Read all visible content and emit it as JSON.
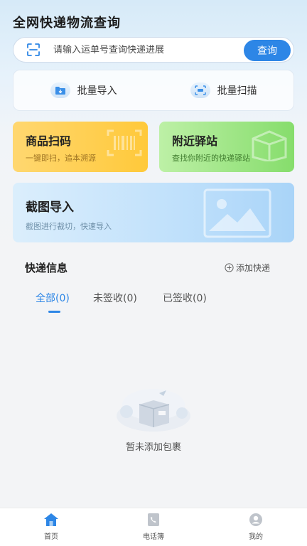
{
  "app": {
    "title": "全网快递物流查询"
  },
  "search": {
    "placeholder": "请输入运单号查询快递进展",
    "button_label": "查询"
  },
  "batch_actions": [
    {
      "label": "批量导入",
      "icon": "import-icon"
    },
    {
      "label": "批量扫描",
      "icon": "scan-icon"
    }
  ],
  "feature_cards": {
    "product_scan": {
      "title": "商品扫码",
      "subtitle": "一键即扫，追本溯源",
      "icon": "barcode-icon"
    },
    "nearby_station": {
      "title": "附近驿站",
      "subtitle": "查找你附近的快递驿站",
      "icon": "parcel-box-icon"
    },
    "screenshot_import": {
      "title": "截图导入",
      "subtitle": "截图进行裁切，快速导入",
      "icon": "image-icon"
    }
  },
  "express_section": {
    "title": "快递信息",
    "add_label": "添加快递",
    "tabs": [
      {
        "label": "全部(0)",
        "active": true
      },
      {
        "label": "未签收(0)",
        "active": false
      },
      {
        "label": "已签收(0)",
        "active": false
      }
    ],
    "empty_text": "暂未添加包裹"
  },
  "bottom_nav": [
    {
      "label": "首页",
      "icon": "home-icon",
      "active": true
    },
    {
      "label": "电话簿",
      "icon": "phone-book-icon",
      "active": false
    },
    {
      "label": "我的",
      "icon": "profile-icon",
      "active": false
    }
  ],
  "colors": {
    "accent": "#2d86e6",
    "yellow_card": "#ffcf52",
    "green_card": "#9fe585",
    "blue_card": "#bfe0fb"
  }
}
